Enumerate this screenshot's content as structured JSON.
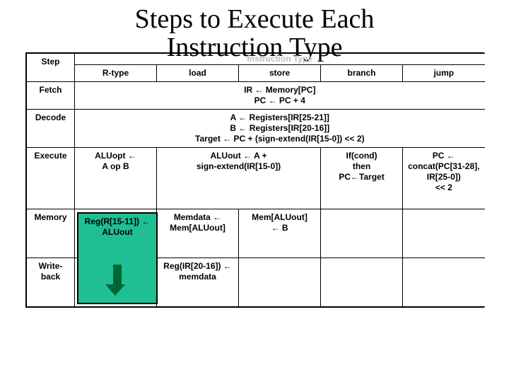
{
  "title_line1": "Steps to Execute Each",
  "title_line2": "Instruction Type",
  "headers": {
    "step": "Step",
    "instruction_type": "Instruction Type",
    "cols": [
      "R-type",
      "load",
      "store",
      "branch",
      "jump"
    ]
  },
  "rows": {
    "fetch": {
      "label": "Fetch",
      "merged": "IR ← Memory[PC]\nPC ← PC + 4"
    },
    "decode": {
      "label": "Decode",
      "merged": "A ← Registers[IR[25-21]]\nB ← Registers[IR[20-16]]\nTarget ← PC + (sign-extend(IR[15-0]) << 2)"
    },
    "execute": {
      "label": "Execute",
      "rtype": "ALUopt ←\nA op B",
      "load_store": "ALUout ← A +\nsign-extend(IR[15-0])",
      "branch": "If(cond)\nthen\nPC←Target",
      "jump": "PC ←\nconcat(PC[31-28], IR[25-0])\n<< 2"
    },
    "memory": {
      "label": "Memory",
      "rtype_green": "Reg(R[15-11]) ←\nALUout",
      "load": "Memdata ←\nMem[ALUout]",
      "store": "Mem[ALUout]\n← B"
    },
    "writeback": {
      "label": "Write-back",
      "load": "Reg(IR[20-16]) ←\nmemdata"
    }
  }
}
